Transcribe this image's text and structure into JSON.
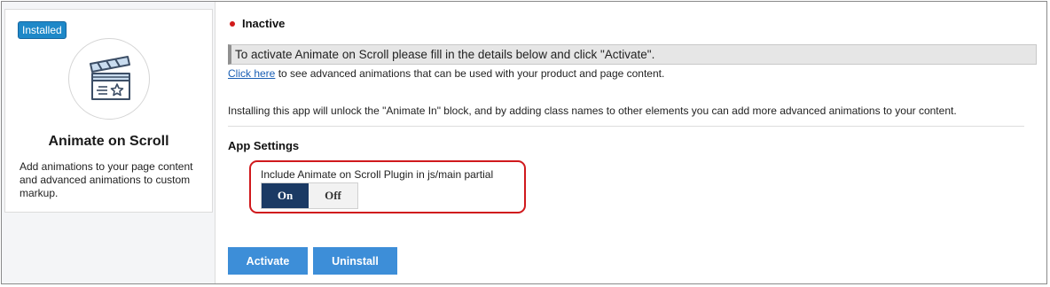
{
  "app": {
    "badge": "Installed",
    "name": "Animate on Scroll",
    "description": "Add animations to your page content and advanced animations to custom markup.",
    "icon": "clapperboard-icon"
  },
  "status": {
    "label": "Inactive",
    "color": "#d11a1a"
  },
  "notice": "To activate Animate on Scroll please fill in the details below and click \"Activate\".",
  "advanced_link": {
    "link_text": "Click here",
    "rest_text": " to see advanced animations that can be used with your product and page content."
  },
  "install_text": "Installing this app will unlock the \"Animate In\" block, and by adding class names to other elements you can add more advanced animations to your content.",
  "settings": {
    "title": "App Settings",
    "plugin_toggle": {
      "label": "Include Animate on Scroll Plugin in js/main partial",
      "on_label": "On",
      "off_label": "Off",
      "selected": "On"
    }
  },
  "buttons": {
    "activate": "Activate",
    "uninstall": "Uninstall"
  },
  "colors": {
    "accent": "#3d8ed8",
    "toggle_active": "#1b3a64",
    "highlight": "#d0191d",
    "badge": "#1e88c8"
  }
}
